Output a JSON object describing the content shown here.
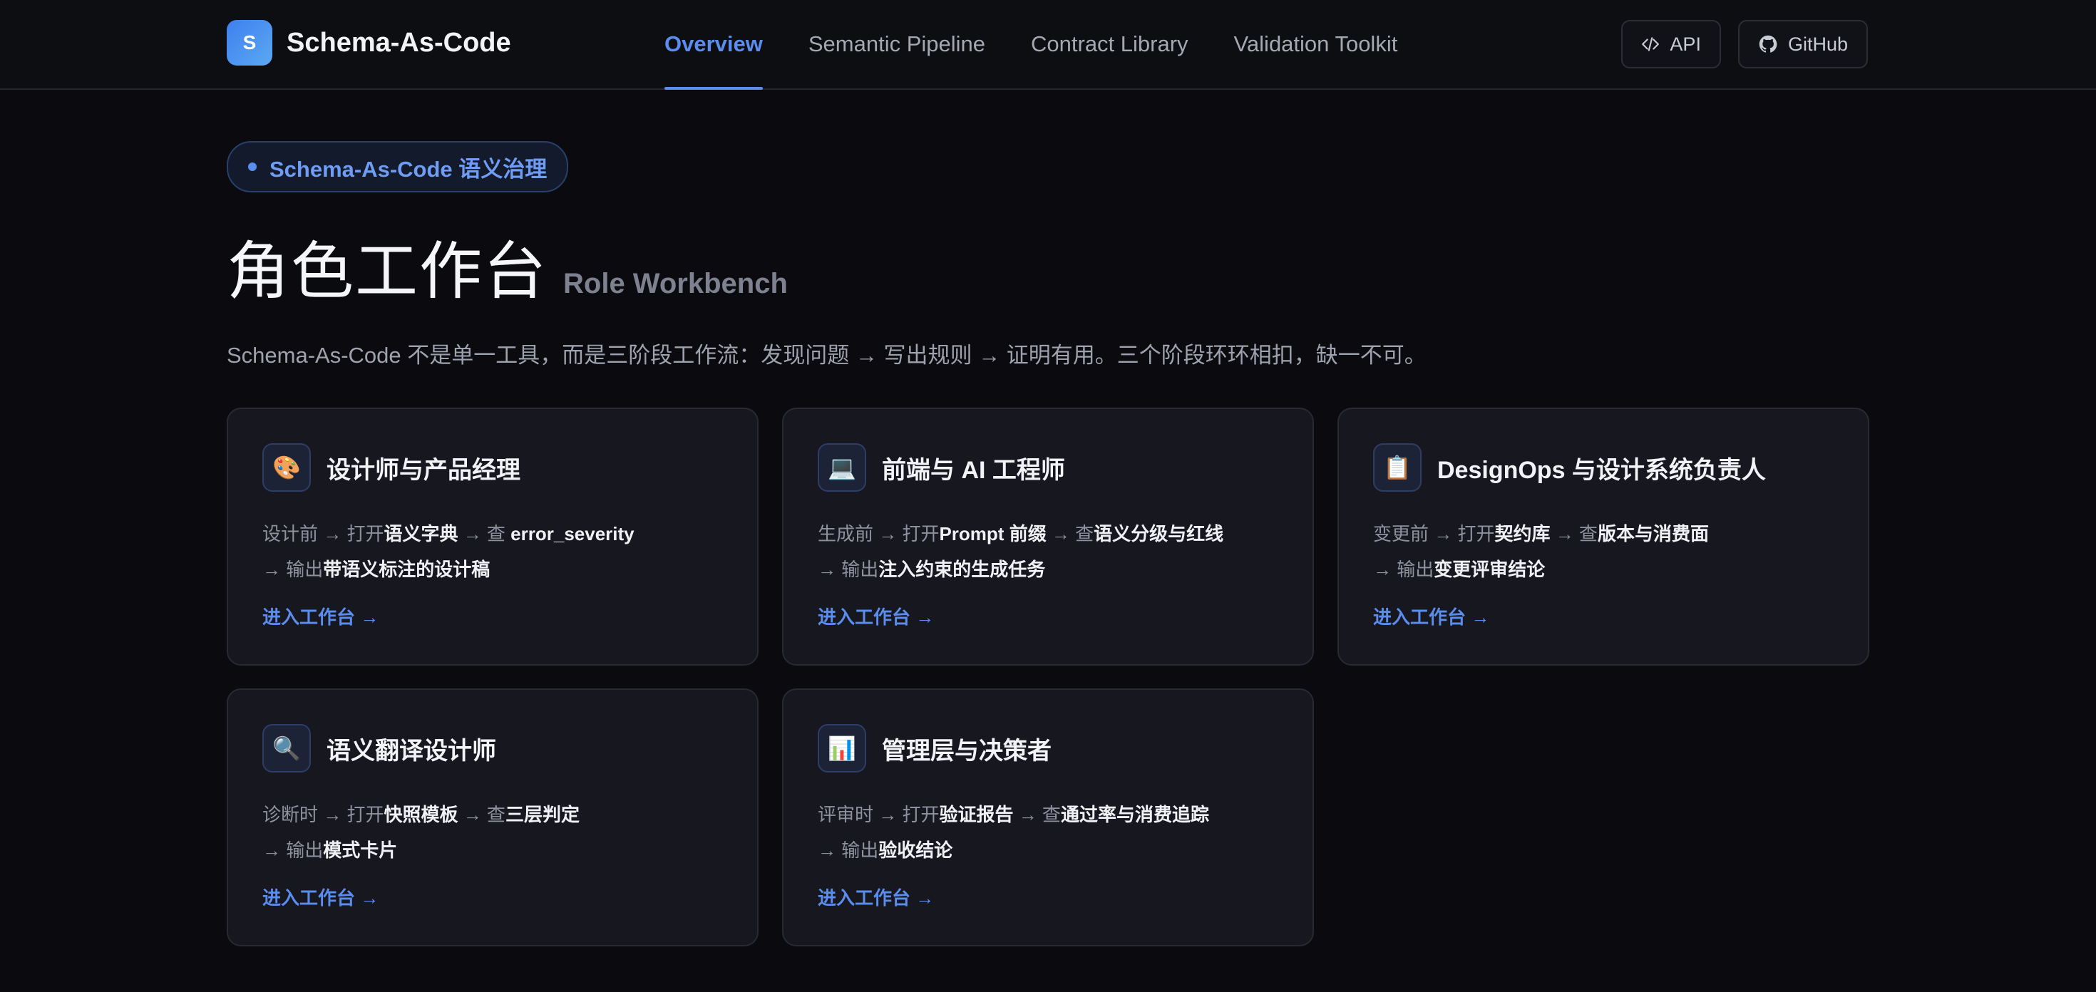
{
  "header": {
    "logo_letter": "S",
    "brand": "Schema-As-Code",
    "nav": [
      {
        "label": "Overview",
        "active": true
      },
      {
        "label": "Semantic Pipeline",
        "active": false
      },
      {
        "label": "Contract Library",
        "active": false
      },
      {
        "label": "Validation Toolkit",
        "active": false
      }
    ],
    "actions": {
      "api_label": "API",
      "github_label": "GitHub"
    }
  },
  "hero": {
    "badge": "Schema-As-Code 语义治理",
    "title": "角色工作台",
    "subtitle": "Role Workbench",
    "description": "Schema-As-Code 不是单一工具，而是三阶段工作流：发现问题 → 写出规则 → 证明有用。三个阶段环环相扣，缺一不可。"
  },
  "cards": [
    {
      "icon": "🎨",
      "icon_name": "palette-icon",
      "title": "设计师与产品经理",
      "when": "设计前",
      "open_prefix": " → 打开",
      "open": "语义字典",
      "check_prefix": " → 查 ",
      "check": "error_severity",
      "output_prefix": "→ 输出",
      "output": "带语义标注的设计稿",
      "link": "进入工作台 →"
    },
    {
      "icon": "💻",
      "icon_name": "laptop-icon",
      "title": "前端与 AI 工程师",
      "when": "生成前",
      "open_prefix": " → 打开",
      "open": "Prompt 前缀",
      "check_prefix": " → 查",
      "check": "语义分级与红线",
      "output_prefix": "→ 输出",
      "output": "注入约束的生成任务",
      "link": "进入工作台 →"
    },
    {
      "icon": "📋",
      "icon_name": "clipboard-icon",
      "title": "DesignOps 与设计系统负责人",
      "when": "变更前",
      "open_prefix": " → 打开",
      "open": "契约库",
      "check_prefix": " → 查",
      "check": "版本与消费面",
      "output_prefix": "→ 输出",
      "output": "变更评审结论",
      "link": "进入工作台 →"
    },
    {
      "icon": "🔍",
      "icon_name": "magnifier-icon",
      "title": "语义翻译设计师",
      "when": "诊断时",
      "open_prefix": " → 打开",
      "open": "快照模板",
      "check_prefix": " → 查",
      "check": "三层判定",
      "output_prefix": "→ 输出",
      "output": "模式卡片",
      "link": "进入工作台 →"
    },
    {
      "icon": "📊",
      "icon_name": "bar-chart-icon",
      "title": "管理层与决策者",
      "when": "评审时",
      "open_prefix": " → 打开",
      "open": "验证报告",
      "check_prefix": " → 查",
      "check": "通过率与消费追踪",
      "output_prefix": "→ 输出",
      "output": "验收结论",
      "link": "进入工作台 →"
    }
  ]
}
